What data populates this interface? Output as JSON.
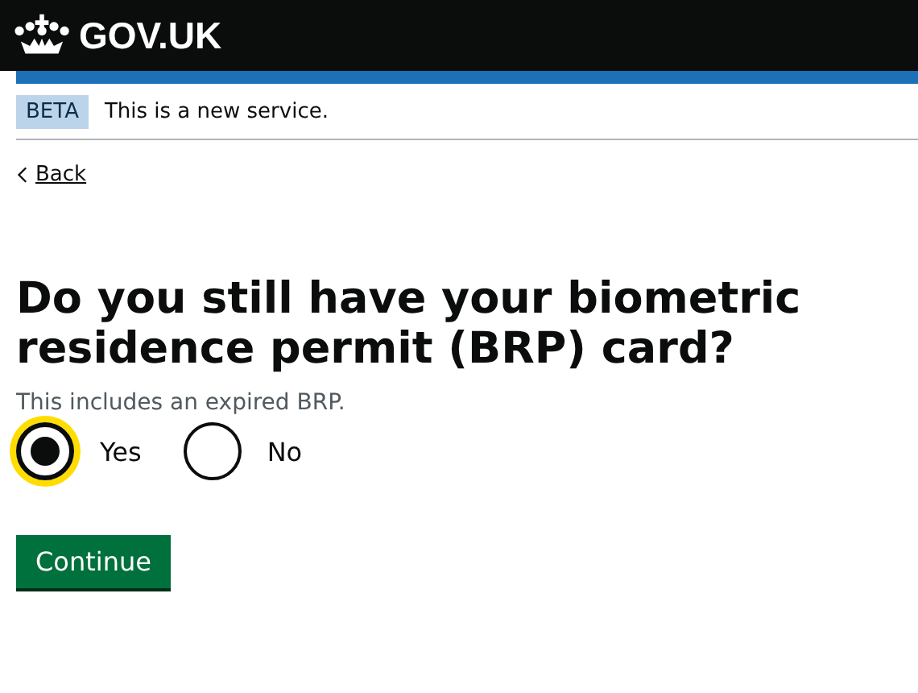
{
  "header": {
    "logo_text": "GOV.UK"
  },
  "phase_banner": {
    "tag": "BETA",
    "text": "This is a new service."
  },
  "back_link": {
    "label": "Back"
  },
  "question": {
    "heading": "Do you still have your biometric residence permit (BRP) card?",
    "hint": "This includes an expired BRP.",
    "options": [
      {
        "label": "Yes",
        "selected": true,
        "focused": true
      },
      {
        "label": "No",
        "selected": false,
        "focused": false
      }
    ]
  },
  "buttons": [
    {
      "label": "Continue"
    }
  ]
}
